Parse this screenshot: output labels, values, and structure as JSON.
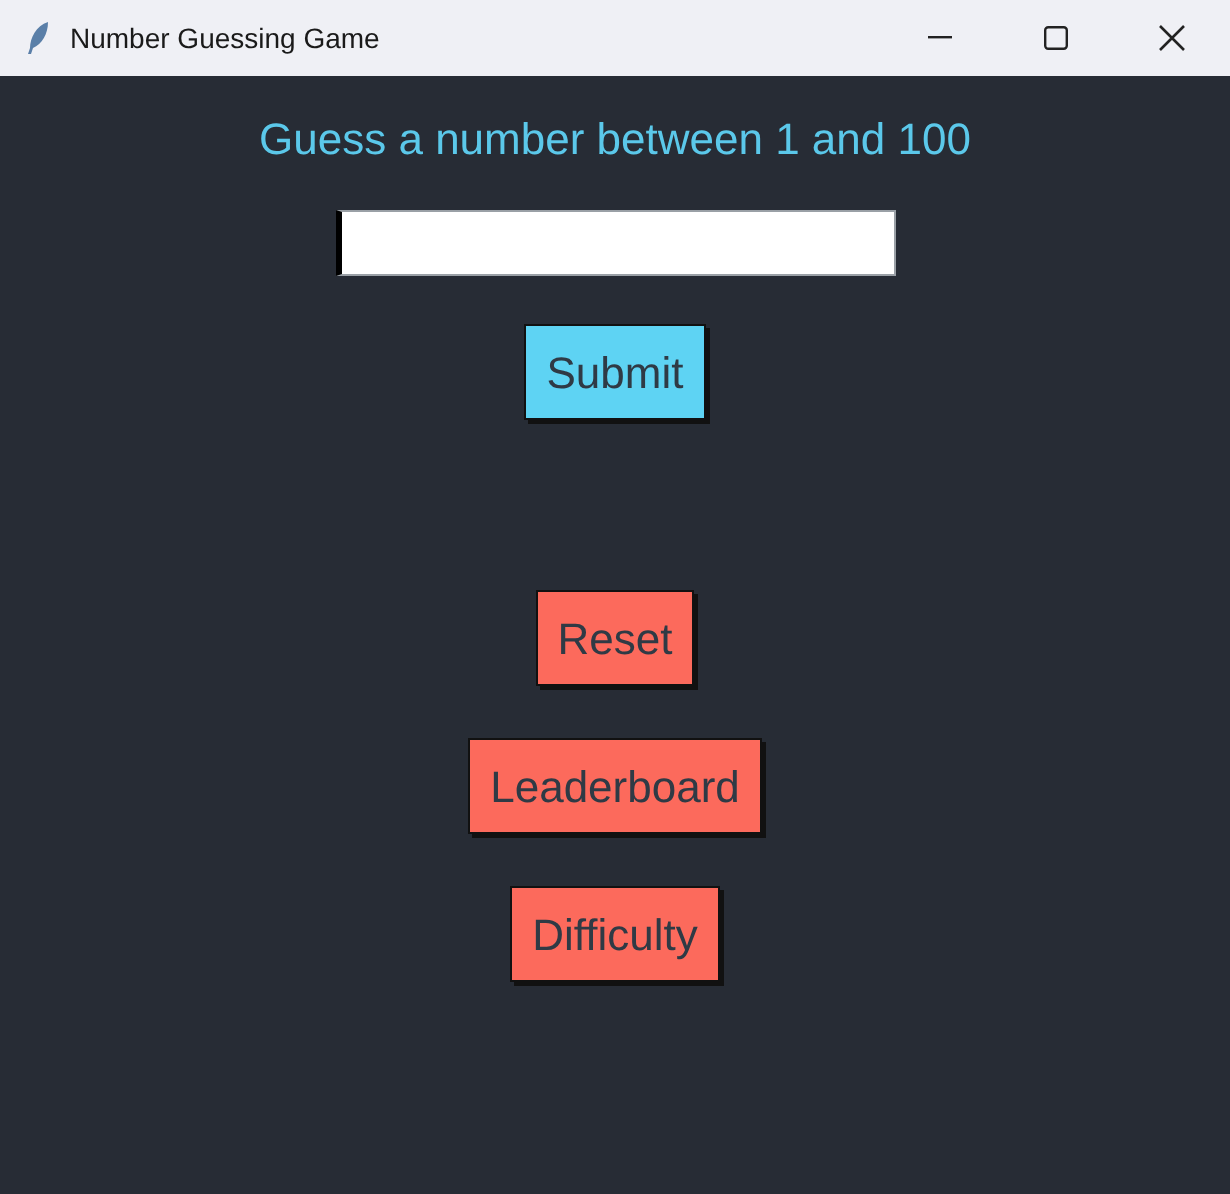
{
  "window": {
    "title": "Number Guessing Game"
  },
  "prompt": "Guess a number between 1 and 100",
  "buttons": [
    {
      "label": "Submit",
      "kind": "primary"
    },
    {
      "label": "Reset",
      "kind": "secondary"
    },
    {
      "label": "Leaderboard",
      "kind": "secondary"
    },
    {
      "label": "Difficulty",
      "kind": "secondary"
    }
  ]
}
